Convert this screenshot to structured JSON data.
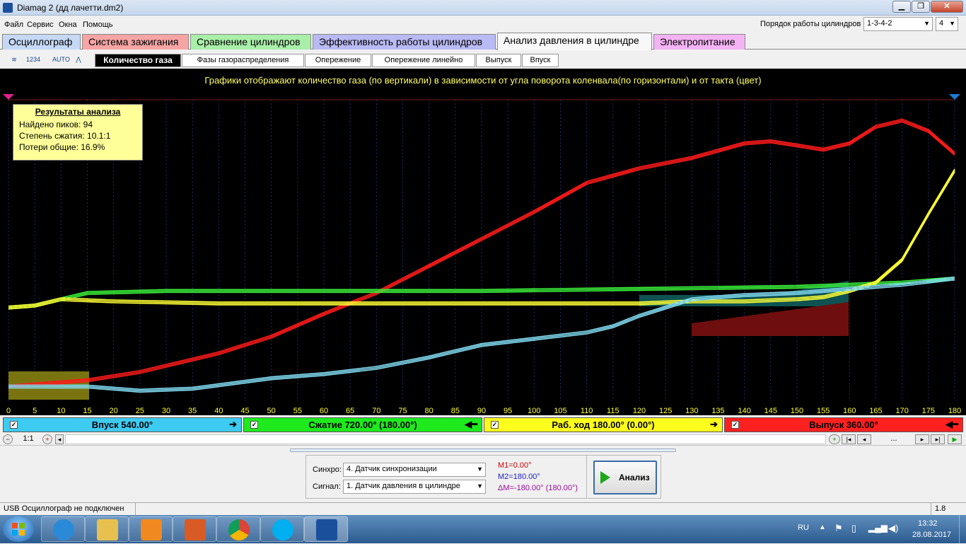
{
  "window": {
    "title": "Diamag 2 (дд лачетти.dm2)",
    "min_label": "0",
    "max_label": "1",
    "close_label": "X"
  },
  "menu": [
    "Файл",
    "Сервис",
    "Окна",
    "Помощь"
  ],
  "cylinder_order": {
    "label": "Порядок работы цилиндров",
    "value": "1-3-4-2",
    "count": "4"
  },
  "tabs": [
    {
      "label": "Осциллограф",
      "color": "#c5d9f6"
    },
    {
      "label": "Система зажигания",
      "color": "#f6a4a4"
    },
    {
      "label": "Сравнение цилиндров",
      "color": "#a9eea9"
    },
    {
      "label": "Эффективность работы цилиндров",
      "color": "#b9b9f4"
    },
    {
      "label": "Анализ давления в цилиндре",
      "color": "#f8f8f8"
    },
    {
      "label": "Электропитание",
      "color": "#f4b3f4"
    }
  ],
  "toolbar_icons": [
    "osc-icon",
    "export-1234-icon",
    "auto-icon",
    "scale-icon"
  ],
  "toolbar_icon_text": [
    "",
    "1234",
    "AUTO",
    ""
  ],
  "subtabs": [
    "Количество газа",
    "Фазы газораспределения",
    "Опережение",
    "Опережение линейно",
    "Выпуск",
    "Впуск"
  ],
  "plot": {
    "caption": "Графики отображают количество газа (по вертикали) в зависимости от угла поворота коленвала(по горизонтали) и от такта (цвет)",
    "results": {
      "title": "Результаты анализа",
      "lines": [
        "Найдено пиков: 94",
        "Степень сжатия: 10.1:1",
        "Потери общие: 16.9%"
      ]
    }
  },
  "chart_data": {
    "type": "line",
    "x_ticks": [
      0,
      5,
      10,
      15,
      20,
      25,
      30,
      35,
      40,
      45,
      50,
      55,
      60,
      65,
      70,
      75,
      80,
      85,
      90,
      95,
      100,
      105,
      110,
      115,
      120,
      125,
      130,
      135,
      140,
      145,
      150,
      155,
      160,
      165,
      170,
      175,
      180
    ],
    "xlim": [
      0,
      180
    ],
    "grid": true,
    "series": [
      {
        "color": "#ff1a1a",
        "x": [
          0,
          15,
          25,
          40,
          50,
          60,
          70,
          80,
          90,
          100,
          110,
          120,
          130,
          140,
          145,
          150,
          155,
          160,
          165,
          170,
          175,
          180
        ],
        "y": [
          0.02,
          0.05,
          0.09,
          0.18,
          0.26,
          0.37,
          0.47,
          0.6,
          0.73,
          0.86,
          1.0,
          1.07,
          1.12,
          1.19,
          1.2,
          1.18,
          1.16,
          1.19,
          1.27,
          1.3,
          1.25,
          1.14
        ]
      },
      {
        "color": "#3af03a",
        "x": [
          0,
          5,
          10,
          15,
          30,
          60,
          90,
          120,
          150,
          160,
          170,
          180
        ],
        "y": [
          0.4,
          0.41,
          0.44,
          0.47,
          0.48,
          0.48,
          0.48,
          0.49,
          0.5,
          0.51,
          0.52,
          0.54
        ]
      },
      {
        "color": "#ffff33",
        "x": [
          0,
          5,
          10,
          20,
          40,
          60,
          90,
          120,
          130,
          140,
          150,
          155,
          160,
          165,
          170,
          175,
          180
        ],
        "y": [
          0.4,
          0.41,
          0.44,
          0.43,
          0.42,
          0.42,
          0.42,
          0.42,
          0.43,
          0.43,
          0.44,
          0.45,
          0.48,
          0.52,
          0.63,
          0.85,
          1.06
        ]
      },
      {
        "color": "#7fd8ee",
        "x": [
          0,
          15,
          25,
          35,
          50,
          60,
          70,
          80,
          90,
          100,
          110,
          115,
          120,
          125,
          130,
          140,
          150,
          160,
          170,
          180
        ],
        "y": [
          0.02,
          0.02,
          0.0,
          0.01,
          0.06,
          0.08,
          0.11,
          0.16,
          0.22,
          0.25,
          0.28,
          0.31,
          0.36,
          0.4,
          0.44,
          0.46,
          0.47,
          0.49,
          0.51,
          0.54
        ]
      }
    ],
    "ylim": [
      -0.05,
      1.4
    ]
  },
  "phases": [
    {
      "label": "Впуск 540.00°",
      "color": "#3ecbf2",
      "arrow": "➔"
    },
    {
      "label": "Сжатие 720.00° (180.00°)",
      "color": "#1eea1e",
      "arrow": "◀━"
    },
    {
      "label": "Раб. ход 180.00° (0.00°)",
      "color": "#ffff1e",
      "arrow": "➔"
    },
    {
      "label": "Выпуск 360.00°",
      "color": "#ff2020",
      "arrow": "◀━"
    }
  ],
  "zoom": {
    "label": "1:1",
    "dots": "..."
  },
  "controls": {
    "sync_label": "Синхро:",
    "sync_value": "4.  Датчик синхронизации",
    "signal_label": "Сигнал:",
    "signal_value": "1.  Датчик давления в цилиндре",
    "m1": "M1=0.00°",
    "m2": "M2=180.00°",
    "dm": "ΔM=-180.00° (180.00°)",
    "analyze_label": "Анализ"
  },
  "status": {
    "text": "USB Осциллограф не подключен",
    "version": "1.8"
  },
  "taskbar": {
    "lang": "RU",
    "time": "13:32",
    "date": "28.08.2017"
  }
}
